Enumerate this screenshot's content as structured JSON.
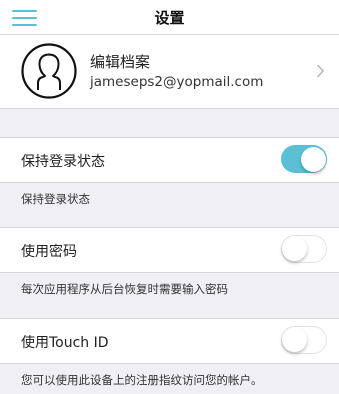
{
  "nav": {
    "title": "设置"
  },
  "profile": {
    "name": "编辑档案",
    "email": "jameseps2@yopmail.com"
  },
  "settings": [
    {
      "label": "保持登录状态",
      "enabled": true,
      "note": "保持登录状态"
    },
    {
      "label": "使用密码",
      "enabled": false,
      "note": "每次应用程序从后台恢复时需要输入密码"
    },
    {
      "label": "使用Touch ID",
      "enabled": false,
      "note": "您可以使用此设备上的注册指纹访问您的帐户。"
    }
  ],
  "colors": {
    "accent": "#5bc0d6"
  }
}
